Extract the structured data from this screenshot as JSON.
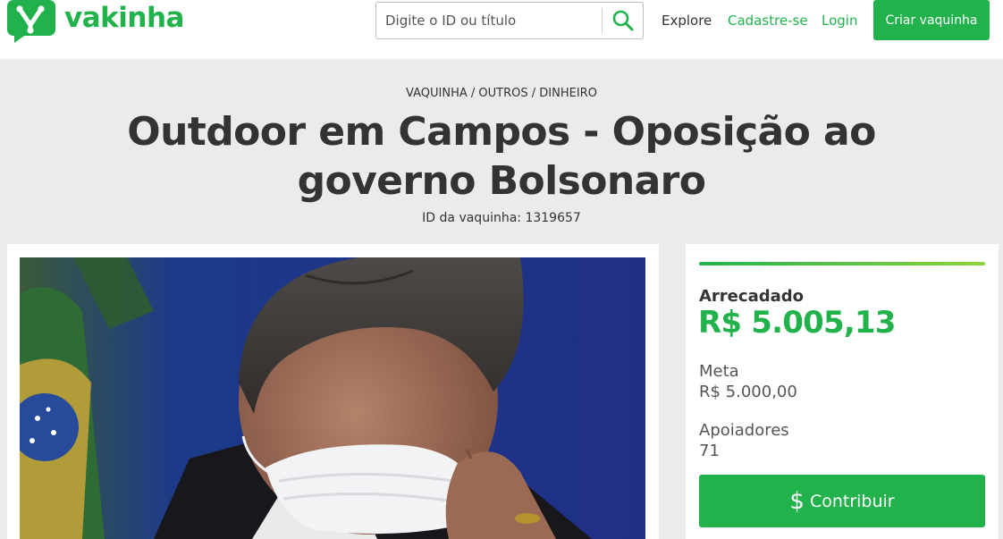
{
  "header": {
    "brand": "vakinha",
    "search": {
      "placeholder": "Digite o ID ou título",
      "icon": "search-icon"
    },
    "nav": {
      "explore": "Explore",
      "signup": "Cadastre-se",
      "login": "Login"
    },
    "cta": "Criar vaquinha"
  },
  "breadcrumb": {
    "root": "VAQUINHA",
    "category": "OUTROS",
    "subcategory": "DINHEIRO",
    "separator": " / "
  },
  "campaign": {
    "title": "Outdoor em Campos - Oposição ao governo Bolsonaro",
    "id_line": "ID da vaquinha: 1319657"
  },
  "stats": {
    "raised_label": "Arrecadado",
    "raised_value": "R$ 5.005,13",
    "goal_label": "Meta",
    "goal_value": "R$ 5.000,00",
    "backers_label": "Apoiadores",
    "backers_value": "71",
    "progress_percent": 100,
    "contribute_label": "Contribuir",
    "contribute_icon": "dollar-icon"
  },
  "colors": {
    "brand_green": "#22b24c",
    "background": "#ebebeb",
    "text": "#333333"
  }
}
